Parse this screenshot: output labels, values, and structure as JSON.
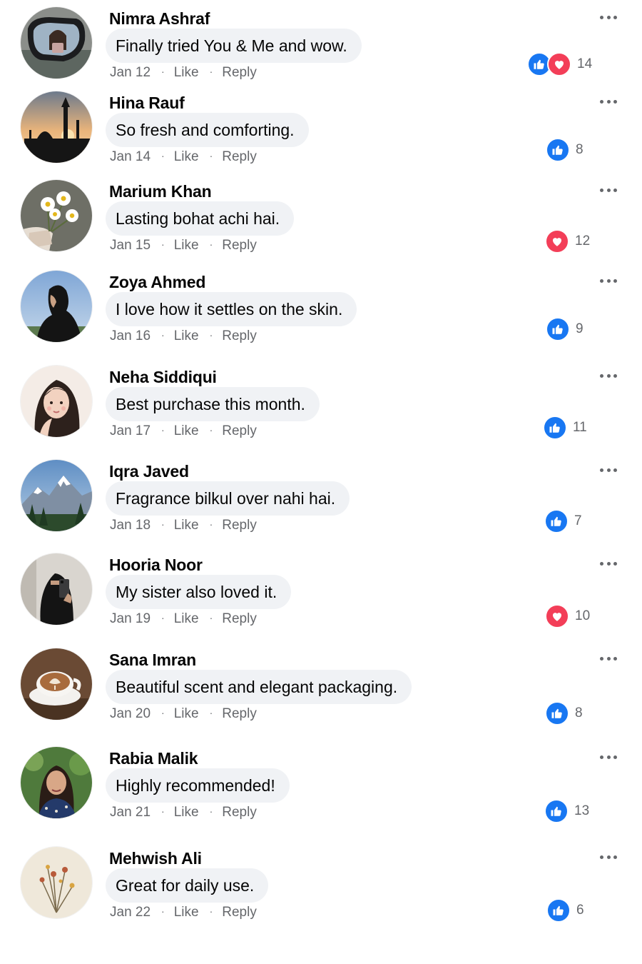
{
  "meta_labels": {
    "like": "Like",
    "reply": "Reply",
    "separator": "·"
  },
  "colors": {
    "like_blue": "#1877f2",
    "love_red": "#f33e58",
    "bubble_bg": "#f0f2f5",
    "meta_gray": "#65676b"
  },
  "comments": [
    {
      "name": "Nimra Ashraf",
      "text": "Finally tried You & Me and wow.",
      "date": "Jan 12",
      "reactions": [
        "like",
        "love"
      ],
      "count": "14",
      "avatar": "car-mirror-selfie"
    },
    {
      "name": "Hina Rauf",
      "text": "So fresh and comforting.",
      "date": "Jan 14",
      "reactions": [
        "like"
      ],
      "count": "8",
      "avatar": "mosque-sunset"
    },
    {
      "name": "Marium Khan",
      "text": "Lasting bohat achi hai.",
      "date": "Jan 15",
      "reactions": [
        "love"
      ],
      "count": "12",
      "avatar": "daisies-in-hand"
    },
    {
      "name": "Zoya Ahmed",
      "text": "I love how it settles on the skin.",
      "date": "Jan 16",
      "reactions": [
        "like"
      ],
      "count": "9",
      "avatar": "hijab-profile-sky"
    },
    {
      "name": "Neha Siddiqui",
      "text": "Best purchase this month.",
      "date": "Jan 17",
      "reactions": [
        "like"
      ],
      "count": "11",
      "avatar": "illustrated-girl"
    },
    {
      "name": "Iqra Javed",
      "text": "Fragrance bilkul over nahi hai.",
      "date": "Jan 18",
      "reactions": [
        "like"
      ],
      "count": "7",
      "avatar": "snowy-mountains"
    },
    {
      "name": "Hooria Noor",
      "text": "My sister also loved it.",
      "date": "Jan 19",
      "reactions": [
        "love"
      ],
      "count": "10",
      "avatar": "niqab-mirror-selfie"
    },
    {
      "name": "Sana Imran",
      "text": "Beautiful scent and elegant packaging.",
      "date": "Jan 20",
      "reactions": [
        "like"
      ],
      "count": "8",
      "avatar": "latte-art-cup"
    },
    {
      "name": "Rabia Malik",
      "text": "Highly recommended!",
      "date": "Jan 21",
      "reactions": [
        "like"
      ],
      "count": "13",
      "avatar": "woman-portrait-garden"
    },
    {
      "name": "Mehwish Ali",
      "text": "Great for daily use.",
      "date": "Jan 22",
      "reactions": [
        "like"
      ],
      "count": "6",
      "avatar": "dried-flowers"
    }
  ]
}
